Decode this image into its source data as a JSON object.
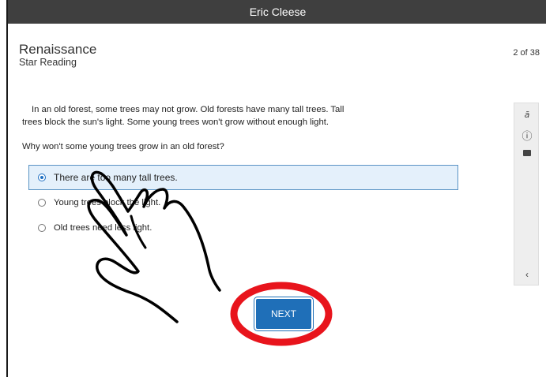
{
  "window": {
    "title": "Eric Cleese"
  },
  "header": {
    "brand": "Renaissance",
    "product": "Star Reading",
    "progress": "2 of 38"
  },
  "passage": {
    "line1": "In an old forest, some trees may not grow. Old forests have many tall trees. Tall",
    "line2": "trees block the sun's light. Some young trees won't grow without enough light."
  },
  "question": "Why won't some young trees grow in an old forest?",
  "options": [
    {
      "label": "There are too many tall trees.",
      "selected": true
    },
    {
      "label": "Young trees block the light.",
      "selected": false
    },
    {
      "label": "Old trees need less light.",
      "selected": false
    }
  ],
  "toolbar": {
    "icons": [
      "translate-icon",
      "accessibility-icon",
      "line-mask-icon",
      "chevron-left-icon"
    ]
  },
  "footer": {
    "next_label": "NEXT"
  },
  "annotation": {
    "circle_color": "#e8141c",
    "hand_color": "#000000"
  }
}
